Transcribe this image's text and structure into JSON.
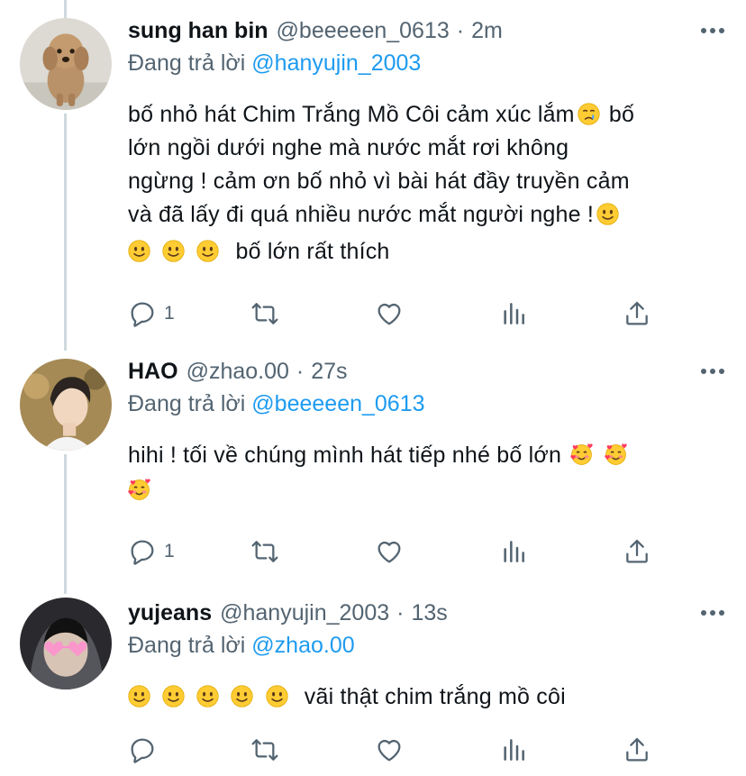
{
  "colors": {
    "link": "#1d9bf0",
    "secondary": "#536471",
    "text": "#0f1419",
    "thread_line": "#cfd9de"
  },
  "tweets": [
    {
      "name": "sung han bin",
      "handle": "@beeeeen_0613",
      "dot": "·",
      "time": "2m",
      "reply_prefix": "Đang trả lời",
      "reply_to": "@hanyujin_2003",
      "avatar": "poodle-photo",
      "text_lines": [
        "bố nhỏ hát Chim Trắng Mồ Côi cảm xúc lắm",
        "bố",
        "lớn ngồi dưới nghe mà nước mắt rơi không",
        "ngừng ! cảm ơn bố nhỏ vì bài hát đầy truyền cảm",
        "và đã lấy đi quá nhiều nước mắt người nghe !",
        "bố lớn rất thích"
      ],
      "reply_count": "1"
    },
    {
      "name": "HAO",
      "handle": "@zhao.00",
      "dot": "·",
      "time": "27s",
      "reply_prefix": "Đang trả lời",
      "reply_to": "@beeeeen_0613",
      "avatar": "young-man-photo",
      "text_lines": [
        "hihi ! tối về chúng mình hát tiếp nhé bố lớn"
      ],
      "reply_count": "1"
    },
    {
      "name": "yujeans",
      "handle": "@hanyujin_2003",
      "dot": "·",
      "time": "13s",
      "reply_prefix": "Đang trả lời",
      "reply_to": "@zhao.00",
      "avatar": "heart-glasses-photo",
      "text_lines": [
        "vãi thật chim trắng mồ côi"
      ],
      "reply_count": ""
    }
  ],
  "icons": [
    "reply-icon",
    "retweet-icon",
    "like-icon",
    "analytics-icon",
    "share-icon",
    "more-icon",
    "slightly-smiling-face-emoji",
    "crying-face-emoji",
    "smiling-face-with-hearts-emoji"
  ]
}
